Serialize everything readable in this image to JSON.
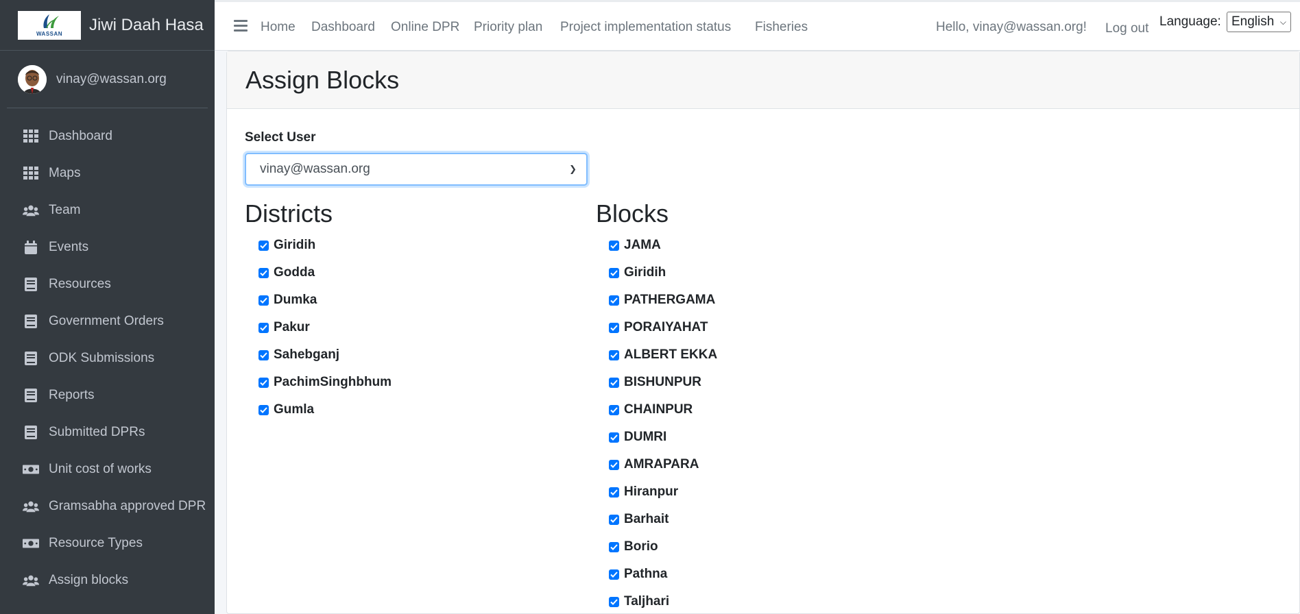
{
  "brand": {
    "name": "Jiwi Daah Hasa",
    "logo_text": "WASSAN"
  },
  "user": {
    "email": "vinay@wassan.org"
  },
  "sidebar": {
    "items": [
      {
        "label": "Dashboard",
        "icon": "grid-icon"
      },
      {
        "label": "Maps",
        "icon": "grid-icon"
      },
      {
        "label": "Team",
        "icon": "users-icon"
      },
      {
        "label": "Events",
        "icon": "calendar-icon"
      },
      {
        "label": "Resources",
        "icon": "book-icon"
      },
      {
        "label": "Government Orders",
        "icon": "book-icon"
      },
      {
        "label": "ODK Submissions",
        "icon": "book-icon"
      },
      {
        "label": "Reports",
        "icon": "book-icon"
      },
      {
        "label": "Submitted DPRs",
        "icon": "book-icon"
      },
      {
        "label": "Unit cost of works",
        "icon": "money-icon"
      },
      {
        "label": "Gramsabha approved DPR",
        "icon": "users-icon"
      },
      {
        "label": "Resource Types",
        "icon": "money-icon"
      },
      {
        "label": "Assign blocks",
        "icon": "users-icon"
      }
    ]
  },
  "topnav": {
    "links": [
      "Home",
      "Dashboard",
      "Online DPR",
      "Priority plan",
      "Project implementation status",
      "Fisheries"
    ],
    "greeting": "Hello, vinay@wassan.org!",
    "logout": "Log out",
    "language_label": "Language:",
    "language_value": "English"
  },
  "page": {
    "title": "Assign Blocks",
    "select_user_label": "Select User",
    "selected_user": "vinay@wassan.org",
    "districts_heading": "Districts",
    "blocks_heading": "Blocks",
    "districts": [
      "Giridih",
      "Godda",
      "Dumka",
      "Pakur",
      "Sahebganj",
      "PachimSinghbhum",
      "Gumla"
    ],
    "blocks": [
      "JAMA",
      "Giridih",
      "PATHERGAMA",
      "PORAIYAHAT",
      "ALBERT EKKA",
      "BISHUNPUR",
      "CHAINPUR",
      "DUMRI",
      "AMRAPARA",
      "Hiranpur",
      "Barhait",
      "Borio",
      "Pathna",
      "Taljhari"
    ]
  },
  "colors": {
    "sidebar_bg": "#343a40",
    "checkbox": "#0075ff",
    "focus": "#80bdff"
  }
}
